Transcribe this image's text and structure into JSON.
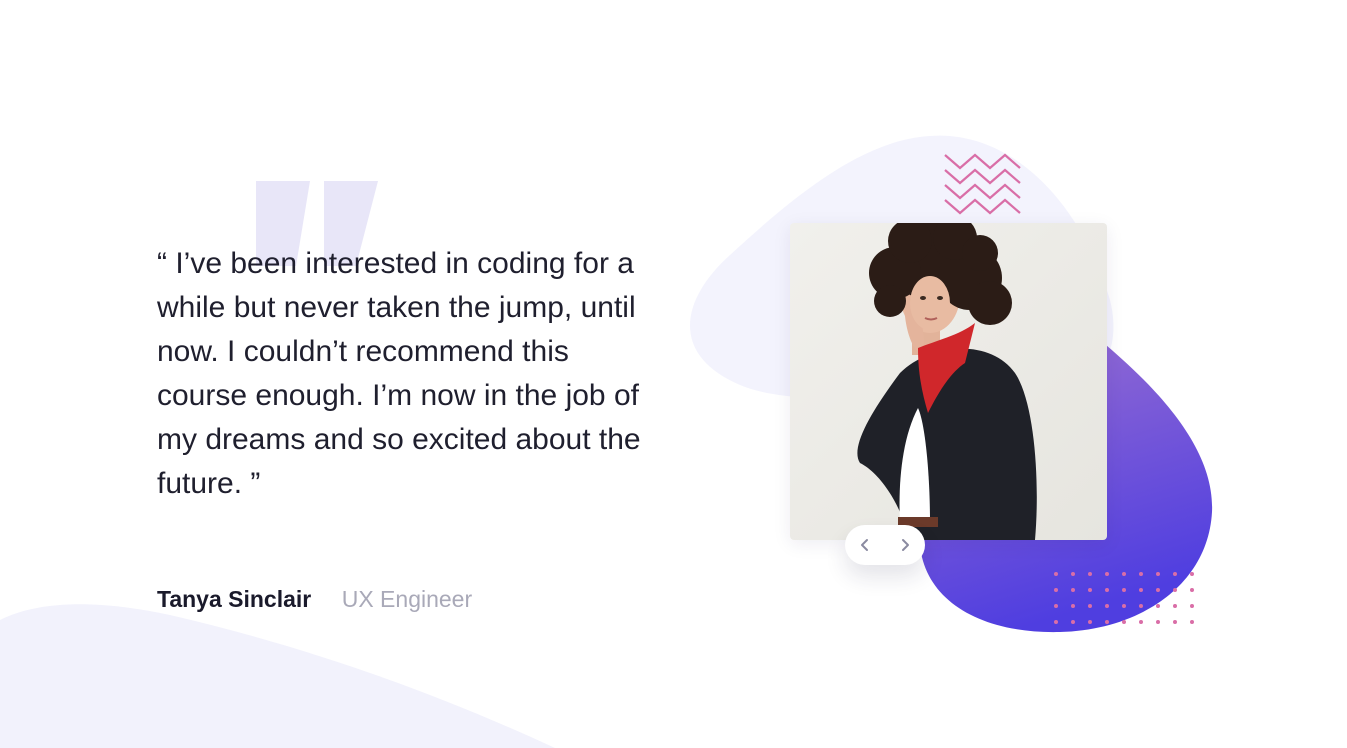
{
  "testimonial": {
    "quote": "“ I’ve been interested in coding for a while but never taken the jump, until now. I couldn’t recommend this course enough. I’m now in the job of my dreams and so excited about the future. ”",
    "author_name": "Tanya Sinclair",
    "author_role": "UX Engineer"
  },
  "slider": {
    "prev_icon": "chevron-left-icon",
    "next_icon": "chevron-right-icon"
  },
  "colors": {
    "background": "#ffffff",
    "curve": "#f2f2fc",
    "quote_mark": "#e8e6f8",
    "blob_light": "#f3f3fd",
    "blob_gradient_start": "#9a6fd1",
    "blob_gradient_end": "#4f3ee0",
    "pattern_pink": "#d96ea7",
    "text_dark": "#1f1f2e",
    "text_muted": "#a9a9b8"
  }
}
